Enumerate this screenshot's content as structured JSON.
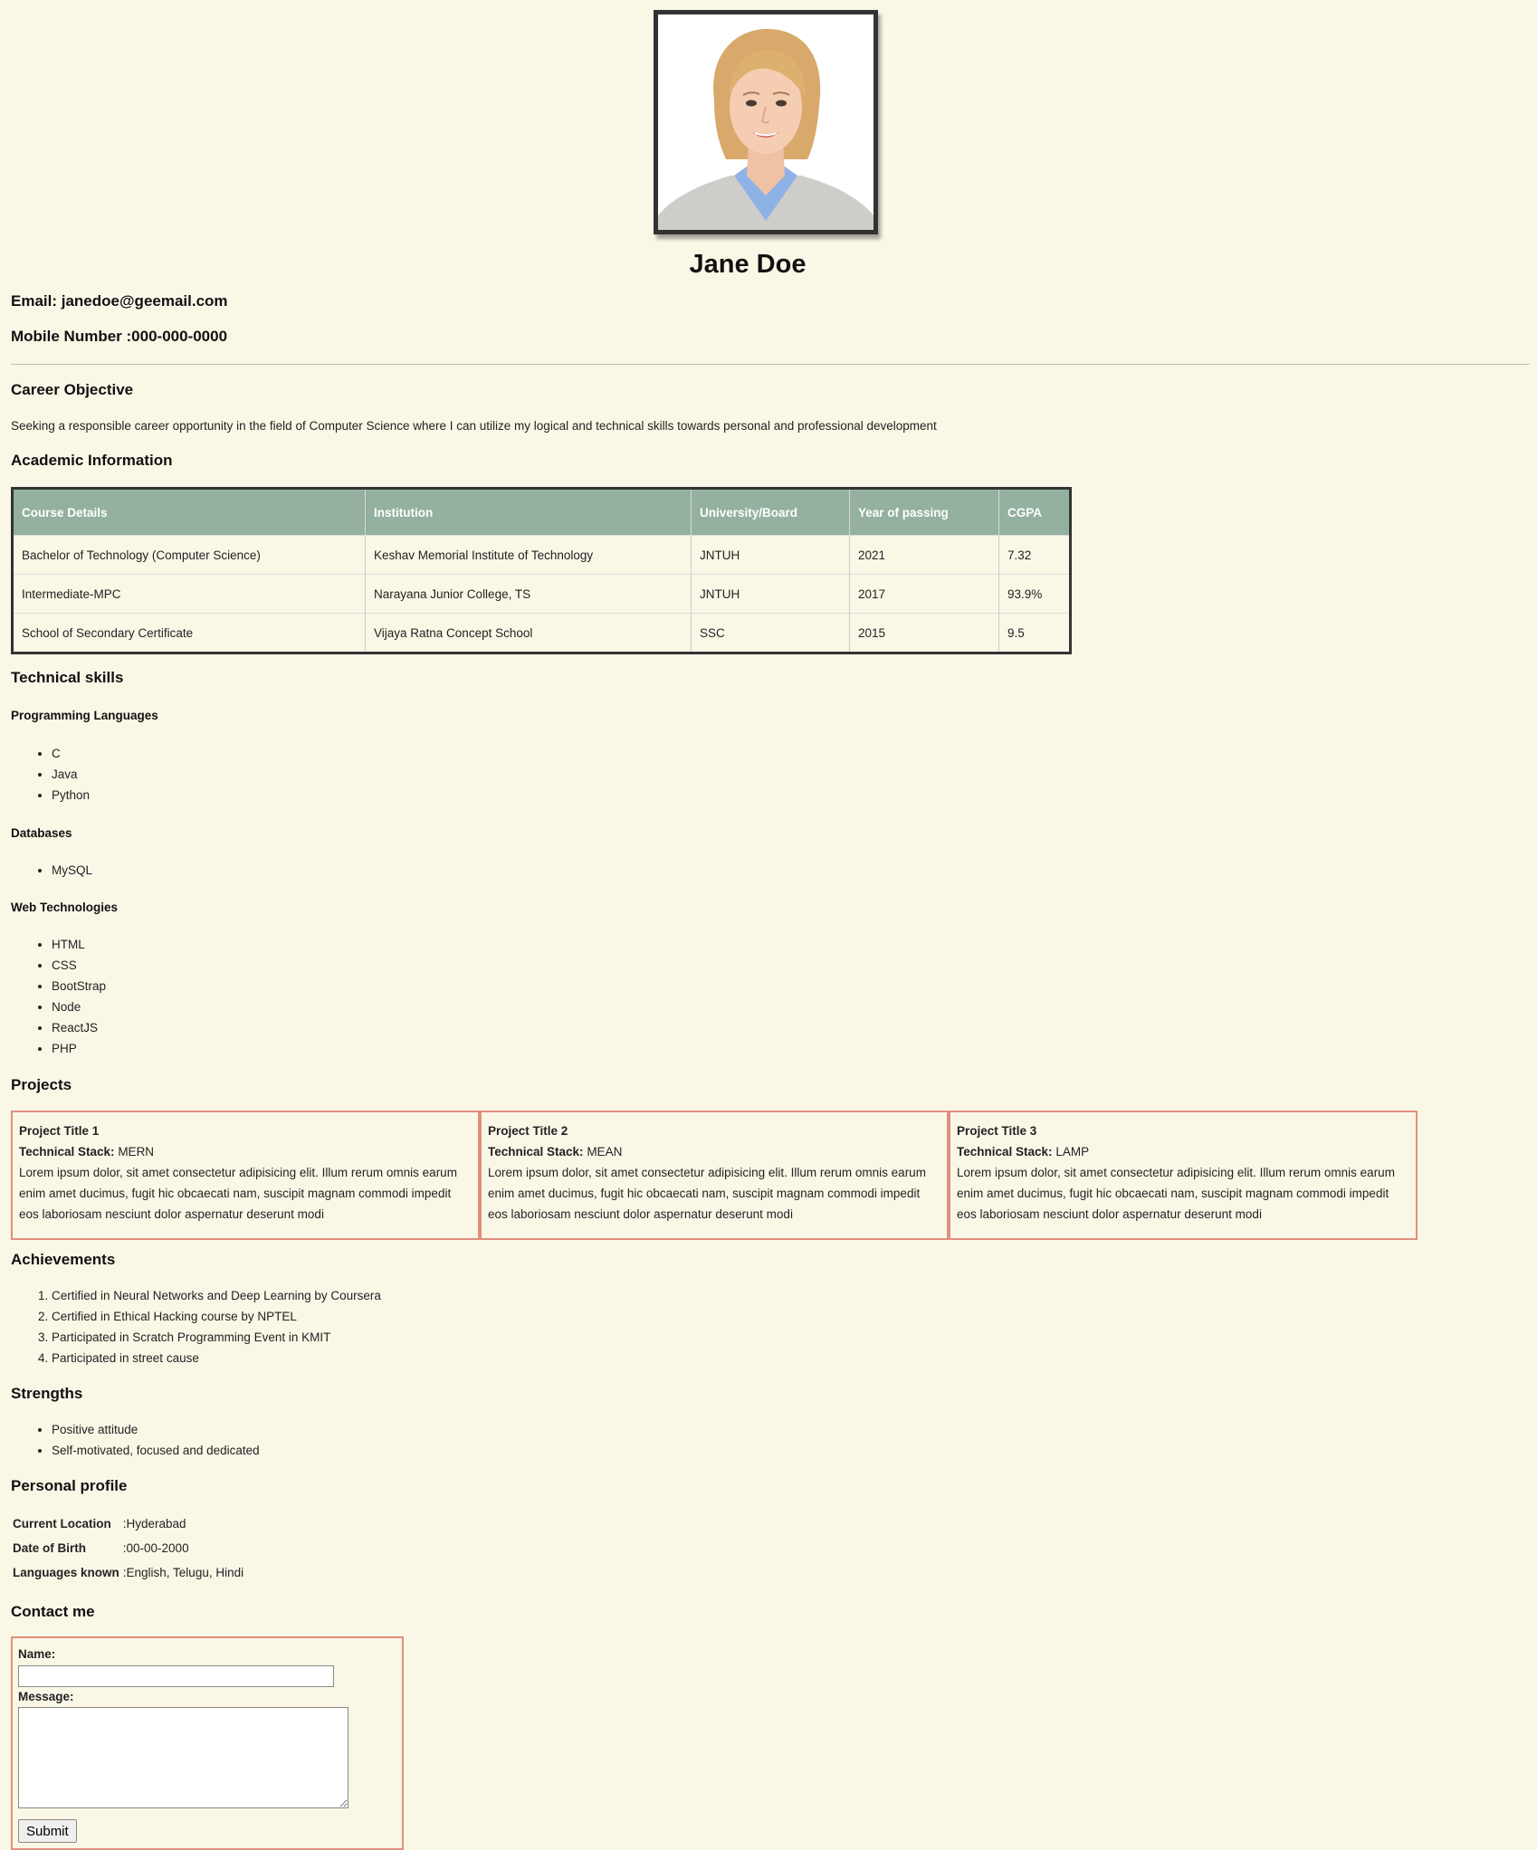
{
  "profile": {
    "name": "Jane Doe",
    "email_label": "Email: janedoe@geemail.com",
    "mobile_label": "Mobile Number :000-000-0000"
  },
  "career_objective": {
    "title": "Career Objective",
    "text": "Seeking a responsible career opportunity in the field of Computer Science where I can utilize my logical and technical skills towards personal and professional development"
  },
  "academic": {
    "title": "Academic Information",
    "headers": [
      "Course Details",
      "Institution",
      "University/Board",
      "Year of passing",
      "CGPA"
    ],
    "rows": [
      [
        "Bachelor of Technology (Computer Science)",
        "Keshav Memorial Institute of Technology",
        "JNTUH",
        "2021",
        "7.32"
      ],
      [
        "Intermediate-MPC",
        "Narayana Junior College, TS",
        "JNTUH",
        "2017",
        "93.9%"
      ],
      [
        "School of Secondary Certificate",
        "Vijaya Ratna Concept School",
        "SSC",
        "2015",
        "9.5"
      ]
    ]
  },
  "skills": {
    "title": "Technical skills",
    "programming": {
      "title": "Programming Languages",
      "items": [
        "C",
        "Java",
        "Python"
      ]
    },
    "databases": {
      "title": "Databases",
      "items": [
        "MySQL"
      ]
    },
    "web": {
      "title": "Web Technologies",
      "items": [
        "HTML",
        "CSS",
        "BootStrap",
        "Node",
        "ReactJS",
        "PHP"
      ]
    }
  },
  "projects": {
    "title": "Projects",
    "stack_label": "Technical Stack:",
    "items": [
      {
        "title": "Project Title 1",
        "stack": "MERN",
        "description": "Lorem ipsum dolor, sit amet consectetur adipisicing elit. Illum rerum omnis earum enim amet ducimus, fugit hic obcaecati nam, suscipit magnam commodi impedit eos laboriosam nesciunt dolor aspernatur deserunt modi"
      },
      {
        "title": "Project Title 2",
        "stack": "MEAN",
        "description": "Lorem ipsum dolor, sit amet consectetur adipisicing elit. Illum rerum omnis earum enim amet ducimus, fugit hic obcaecati nam, suscipit magnam commodi impedit eos laboriosam nesciunt dolor aspernatur deserunt modi"
      },
      {
        "title": "Project Title 3",
        "stack": "LAMP",
        "description": "Lorem ipsum dolor, sit amet consectetur adipisicing elit. Illum rerum omnis earum enim amet ducimus, fugit hic obcaecati nam, suscipit magnam commodi impedit eos laboriosam nesciunt dolor aspernatur deserunt modi"
      }
    ]
  },
  "achievements": {
    "title": "Achievements",
    "items": [
      "Certified in Neural Networks and Deep Learning by Coursera",
      "Certified in Ethical Hacking course by NPTEL",
      "Participated in Scratch Programming Event in KMIT",
      "Participated in street cause"
    ]
  },
  "strengths": {
    "title": "Strengths",
    "items": [
      "Positive attitude",
      "Self-motivated, focused and dedicated"
    ]
  },
  "personal_profile": {
    "title": "Personal profile",
    "rows": [
      {
        "label": "Current Location",
        "value": ":Hyderabad"
      },
      {
        "label": "Date of Birth",
        "value": ":00-00-2000"
      },
      {
        "label": "Languages known",
        "value": ":English, Telugu, Hindi"
      }
    ]
  },
  "contact_form": {
    "title": "Contact me",
    "name_label": "Name:",
    "name_value": "",
    "message_label": "Message:",
    "message_value": "",
    "submit_label": "Submit"
  }
}
